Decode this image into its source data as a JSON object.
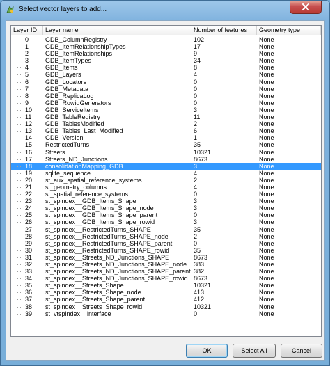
{
  "window": {
    "title": "Select vector layers to add..."
  },
  "table": {
    "columns": [
      "Layer ID",
      "Layer name",
      "Number of features",
      "Geometry type"
    ],
    "selected_index": 18,
    "rows": [
      {
        "id": "0",
        "name": "GDB_ColumnRegistry",
        "count": "102",
        "geom": "None"
      },
      {
        "id": "1",
        "name": "GDB_ItemRelationshipTypes",
        "count": "17",
        "geom": "None"
      },
      {
        "id": "2",
        "name": "GDB_ItemRelationships",
        "count": "9",
        "geom": "None"
      },
      {
        "id": "3",
        "name": "GDB_ItemTypes",
        "count": "34",
        "geom": "None"
      },
      {
        "id": "4",
        "name": "GDB_Items",
        "count": "8",
        "geom": "None"
      },
      {
        "id": "5",
        "name": "GDB_Layers",
        "count": "4",
        "geom": "None"
      },
      {
        "id": "6",
        "name": "GDB_Locators",
        "count": "0",
        "geom": "None"
      },
      {
        "id": "7",
        "name": "GDB_Metadata",
        "count": "0",
        "geom": "None"
      },
      {
        "id": "8",
        "name": "GDB_ReplicaLog",
        "count": "0",
        "geom": "None"
      },
      {
        "id": "9",
        "name": "GDB_RowidGenerators",
        "count": "0",
        "geom": "None"
      },
      {
        "id": "10",
        "name": "GDB_ServiceItems",
        "count": "3",
        "geom": "None"
      },
      {
        "id": "11",
        "name": "GDB_TableRegistry",
        "count": "11",
        "geom": "None"
      },
      {
        "id": "12",
        "name": "GDB_TablesModified",
        "count": "2",
        "geom": "None"
      },
      {
        "id": "13",
        "name": "GDB_Tables_Last_Modified",
        "count": "6",
        "geom": "None"
      },
      {
        "id": "14",
        "name": "GDB_Version",
        "count": "1",
        "geom": "None"
      },
      {
        "id": "15",
        "name": "RestrictedTurns",
        "count": "35",
        "geom": "None"
      },
      {
        "id": "16",
        "name": "Streets",
        "count": "10321",
        "geom": "None"
      },
      {
        "id": "17",
        "name": "Streets_ND_Junctions",
        "count": "8673",
        "geom": "None"
      },
      {
        "id": "18",
        "name": "consolidationMapping_GDB",
        "count": "3",
        "geom": "None"
      },
      {
        "id": "19",
        "name": "sqlite_sequence",
        "count": "4",
        "geom": "None"
      },
      {
        "id": "20",
        "name": "st_aux_spatial_reference_systems",
        "count": "2",
        "geom": "None"
      },
      {
        "id": "21",
        "name": "st_geometry_columns",
        "count": "4",
        "geom": "None"
      },
      {
        "id": "22",
        "name": "st_spatial_reference_systems",
        "count": "0",
        "geom": "None"
      },
      {
        "id": "23",
        "name": "st_spindex__GDB_Items_Shape",
        "count": "3",
        "geom": "None"
      },
      {
        "id": "24",
        "name": "st_spindex__GDB_Items_Shape_node",
        "count": "3",
        "geom": "None"
      },
      {
        "id": "25",
        "name": "st_spindex__GDB_Items_Shape_parent",
        "count": "0",
        "geom": "None"
      },
      {
        "id": "26",
        "name": "st_spindex__GDB_Items_Shape_rowid",
        "count": "3",
        "geom": "None"
      },
      {
        "id": "27",
        "name": "st_spindex__RestrictedTurns_SHAPE",
        "count": "35",
        "geom": "None"
      },
      {
        "id": "28",
        "name": "st_spindex__RestrictedTurns_SHAPE_node",
        "count": "2",
        "geom": "None"
      },
      {
        "id": "29",
        "name": "st_spindex__RestrictedTurns_SHAPE_parent",
        "count": "0",
        "geom": "None"
      },
      {
        "id": "30",
        "name": "st_spindex__RestrictedTurns_SHAPE_rowid",
        "count": "35",
        "geom": "None"
      },
      {
        "id": "31",
        "name": "st_spindex__Streets_ND_Junctions_SHAPE",
        "count": "8673",
        "geom": "None"
      },
      {
        "id": "32",
        "name": "st_spindex__Streets_ND_Junctions_SHAPE_node",
        "count": "383",
        "geom": "None"
      },
      {
        "id": "33",
        "name": "st_spindex__Streets_ND_Junctions_SHAPE_parent",
        "count": "382",
        "geom": "None"
      },
      {
        "id": "34",
        "name": "st_spindex__Streets_ND_Junctions_SHAPE_rowid",
        "count": "8673",
        "geom": "None"
      },
      {
        "id": "35",
        "name": "st_spindex__Streets_Shape",
        "count": "10321",
        "geom": "None"
      },
      {
        "id": "36",
        "name": "st_spindex__Streets_Shape_node",
        "count": "413",
        "geom": "None"
      },
      {
        "id": "37",
        "name": "st_spindex__Streets_Shape_parent",
        "count": "412",
        "geom": "None"
      },
      {
        "id": "38",
        "name": "st_spindex__Streets_Shape_rowid",
        "count": "10321",
        "geom": "None"
      },
      {
        "id": "39",
        "name": "st_vtspindex__interface",
        "count": "0",
        "geom": "None"
      }
    ]
  },
  "buttons": {
    "ok": "OK",
    "select_all": "Select All",
    "cancel": "Cancel"
  },
  "icons": {
    "app": "qgis-icon",
    "close": "close-icon"
  },
  "colors": {
    "selection": "#3399ff",
    "title_gradient": "#9ec7ea",
    "close_button": "#c75050"
  }
}
